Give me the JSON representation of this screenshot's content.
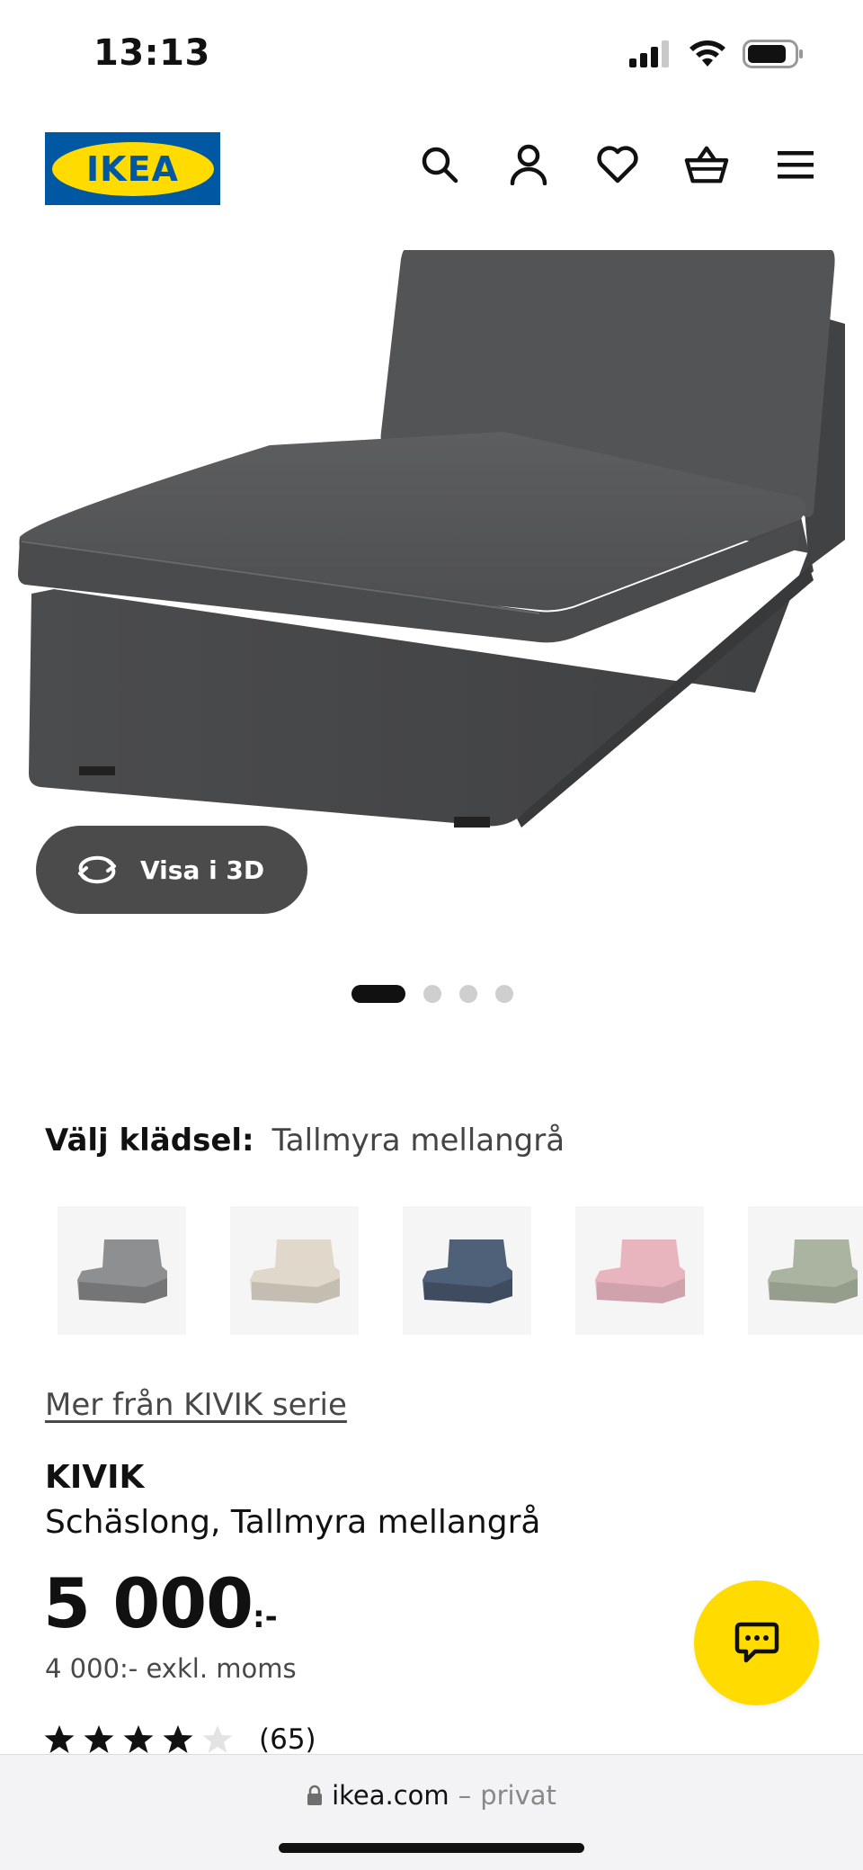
{
  "status_bar": {
    "time": "13:13"
  },
  "header": {
    "logo_text": "IKEA",
    "icons": [
      "search-icon",
      "account-icon",
      "heart-icon",
      "cart-icon",
      "menu-icon"
    ]
  },
  "product_image": {
    "view_3d_label": "Visa i 3D",
    "carousel_total": 4,
    "carousel_active": 1
  },
  "fabric": {
    "label": "Välj klädsel:",
    "selected": "Tallmyra mellangrå",
    "swatches": [
      {
        "color": "#8e8f91"
      },
      {
        "color": "#e0d9cb"
      },
      {
        "color": "#4f6079"
      },
      {
        "color": "#e8b5bf"
      },
      {
        "color": "#aab4a0"
      }
    ]
  },
  "series_link": "Mer från KIVIK serie",
  "product": {
    "name": "KIVIK",
    "description": "Schäslong, Tallmyra mellangrå",
    "price": "5 000",
    "price_suffix": ":-",
    "price_ex_vat": "4 000:- exkl. moms",
    "rating_stars": 4,
    "rating_count": "(65)"
  },
  "browser": {
    "domain": "ikea.com",
    "separator": "–",
    "mode": "privat"
  },
  "colors": {
    "ikea_blue": "#0058A3",
    "ikea_yellow": "#FFDB00",
    "sofa_gray": "#555657"
  }
}
